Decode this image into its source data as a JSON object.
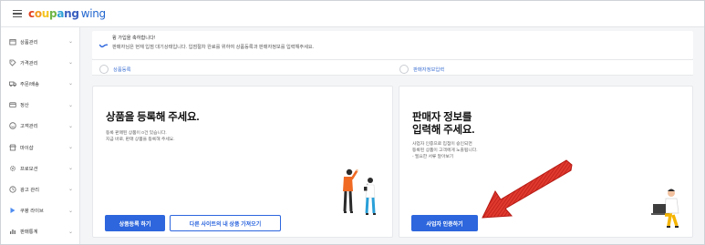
{
  "header": {
    "logo_parts": [
      "c",
      "o",
      "u",
      "p",
      "a",
      "ng"
    ],
    "logo_wing": "wing"
  },
  "sidebar": {
    "items": [
      {
        "label": "상품관리",
        "icon": "box-icon"
      },
      {
        "label": "가격관리",
        "icon": "price-tag-icon"
      },
      {
        "label": "주문/배송",
        "icon": "truck-icon"
      },
      {
        "label": "정산",
        "icon": "wallet-icon"
      },
      {
        "label": "고객관리",
        "icon": "smile-icon"
      },
      {
        "label": "마이샵",
        "icon": "shop-icon"
      },
      {
        "label": "프로모션",
        "icon": "gear-icon"
      },
      {
        "label": "광고 관리",
        "icon": "clock-icon"
      },
      {
        "label": "쿠팡 라이브",
        "icon": "live-icon"
      },
      {
        "label": "판매통계",
        "icon": "bar-chart-icon"
      }
    ]
  },
  "notice": {
    "line1": "윙 가입을 축하합니다!",
    "line2": "판매자님은 현재 입점 대기상태입니다. 입점절차 완료를 위하여 상품등록과 판매자정보를 입력해주세요."
  },
  "steps": {
    "step1": "상품등록",
    "step2": "판매자정보입력"
  },
  "left_card": {
    "title": "상품을 등록해 주세요.",
    "desc1": "등록 판매된 상품이 0건 있습니다.",
    "desc2": "지금 바로, 판매 상품을 등록해 주세요.",
    "primary_button": "상품등록 하기",
    "secondary_button": "다른 사이트의 내 상품 가져오기"
  },
  "right_card": {
    "title_line1": "판매자 정보를",
    "title_line2": "입력해 주세요.",
    "desc1": "사업자 인증으로 입점이 승인되면",
    "desc2": "등록된 상품이 고객에게 노출됩니다.",
    "desc3": "- 필요한 서류 알아보기",
    "primary_button": "사업자 인증하기"
  },
  "colors": {
    "primary": "#2d66dd",
    "arrow": "#d7221d",
    "background": "#f4f5f7"
  }
}
